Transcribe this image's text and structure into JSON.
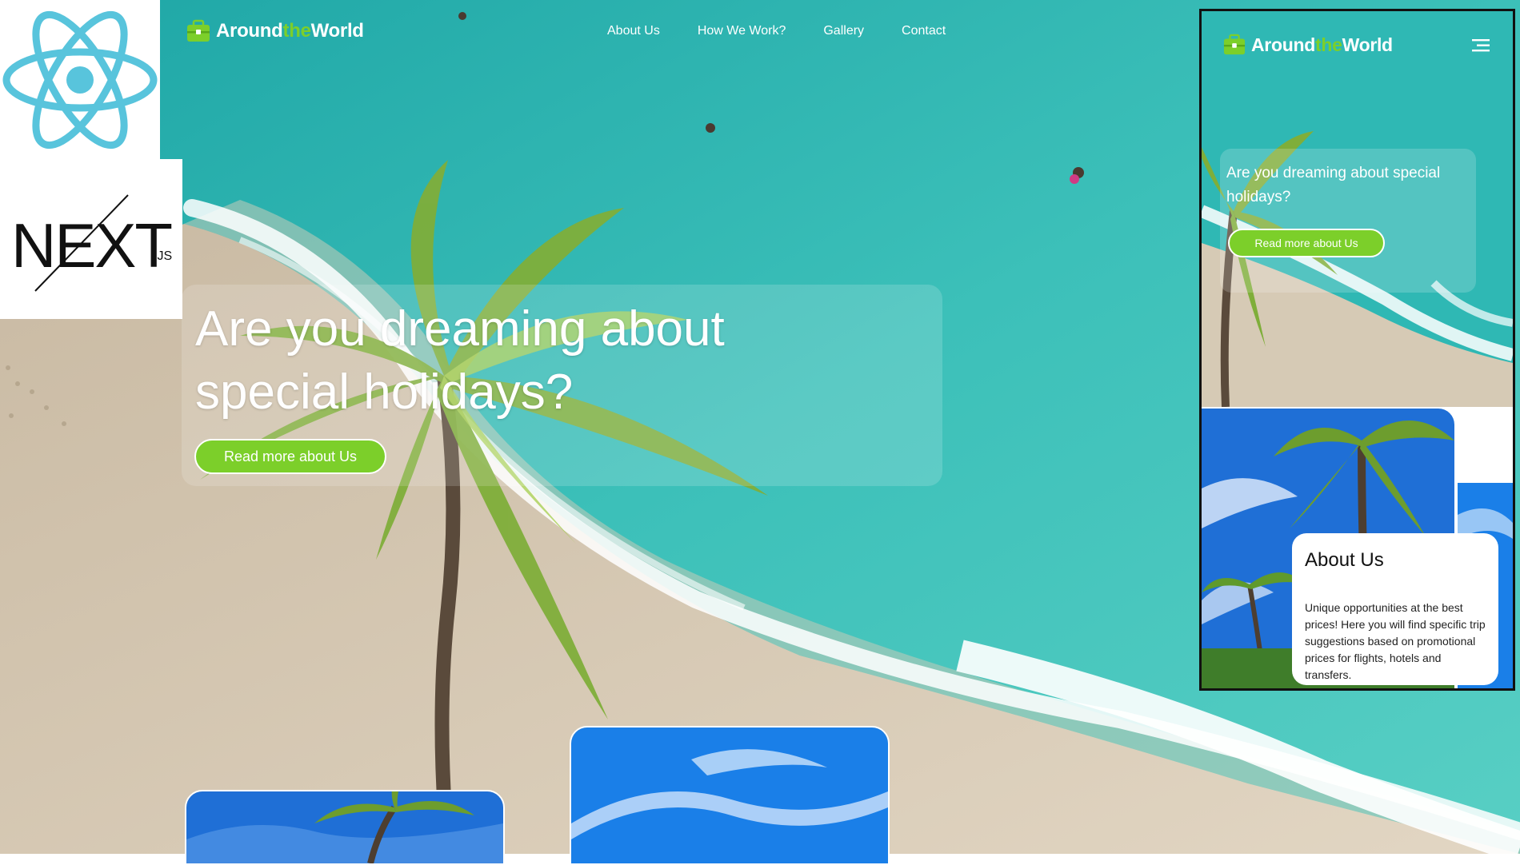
{
  "brand": {
    "part1": "Around",
    "part2": "the",
    "part3": "World"
  },
  "nav": {
    "items": [
      "About Us",
      "How We Work?",
      "Gallery",
      "Contact"
    ]
  },
  "hero": {
    "title": "Are you dreaming about special holidays?",
    "button": "Read more about Us"
  },
  "mobile": {
    "hero_title": "Are you dreaming about special holidays?",
    "button": "Read more about Us",
    "about_title": "About Us",
    "about_text": "Unique opportunities at the best prices! Here you will find specific trip suggestions based on promotional prices for flights, hotels and transfers."
  },
  "badges": {
    "next_main": "NEXT",
    "next_sub": ".JS"
  },
  "icons": {
    "brand": "suitcase-icon",
    "menu": "hamburger-menu-icon",
    "react": "react-logo",
    "next": "nextjs-logo"
  },
  "colors": {
    "accent": "#7ccf2a",
    "sea": "#2fb8b4",
    "sand": "#dcd0bd",
    "react": "#58c4dc"
  }
}
